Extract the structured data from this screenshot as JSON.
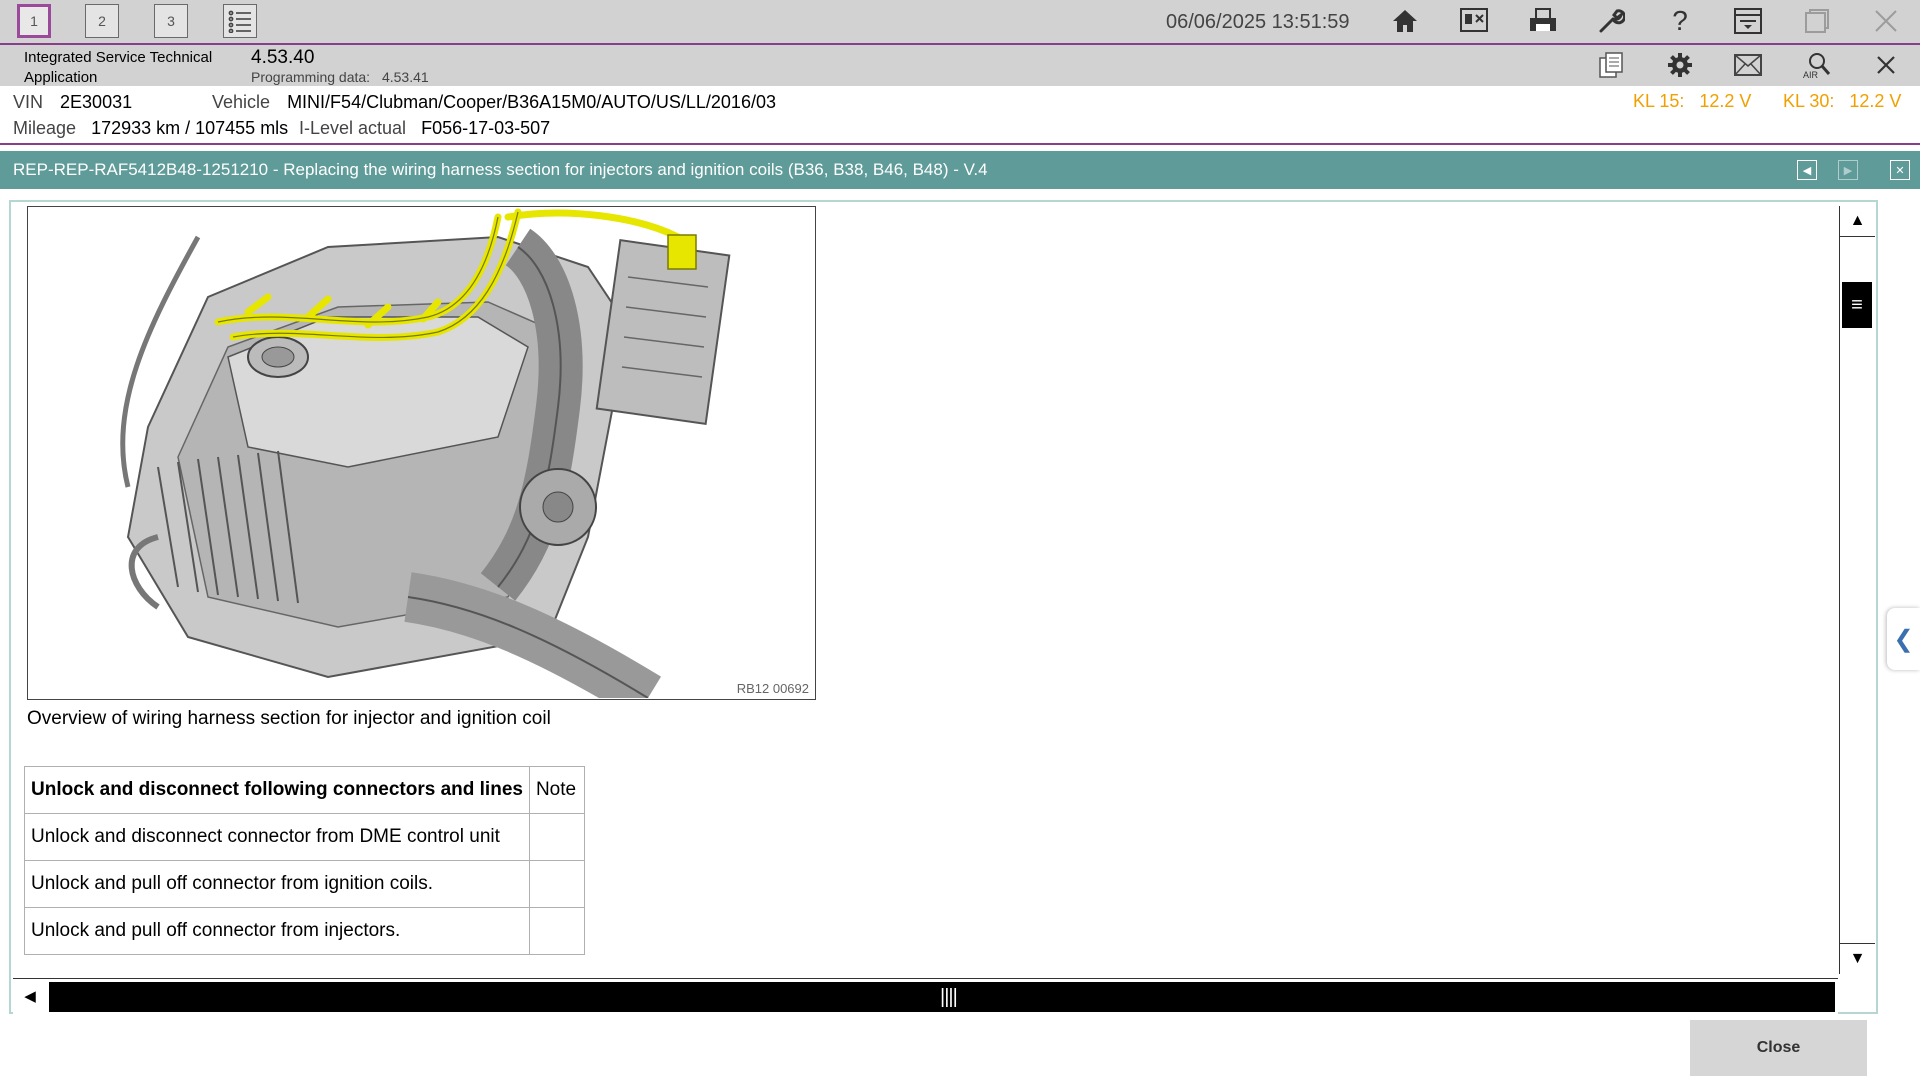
{
  "toolbar": {
    "tabs": [
      "1",
      "2",
      "3"
    ],
    "datetime": "06/06/2025 13:51:59",
    "icons": [
      "list-icon",
      "home-icon",
      "swap-icon",
      "print-icon",
      "wrench-icon",
      "help-icon",
      "download-icon",
      "window-icon",
      "close-icon"
    ]
  },
  "app": {
    "name_line1": "Integrated Service Technical",
    "name_line2": "Application",
    "version": "4.53.40",
    "programming_label": "Programming data:",
    "programming_version": "4.53.41"
  },
  "vehicle": {
    "vin_label": "VIN",
    "vin": "2E30031",
    "vehicle_label": "Vehicle",
    "vehicle": "MINI/F54/Clubman/Cooper/B36A15M0/AUTO/US/LL/2016/03",
    "mileage_label": "Mileage",
    "mileage": "172933 km / 107455 mls",
    "ilevel_label": "I-Level actual",
    "ilevel": "F056-17-03-507",
    "kl15_label": "KL 15:",
    "kl15_value": "12.2 V",
    "kl30_label": "KL 30:",
    "kl30_value": "12.2 V"
  },
  "document": {
    "title": "REP-REP-RAF5412B48-1251210 - Replacing the wiring harness section for injectors and ignition coils (B36, B38, B46, B48) - V.4",
    "figure_code": "RB12 00692",
    "caption": "Overview of wiring harness section for injector and ignition coil",
    "table": {
      "header_step": "Unlock and disconnect following connectors and lines",
      "header_note": "Note",
      "rows": [
        {
          "step": "Unlock and disconnect connector from DME control unit",
          "note": ""
        },
        {
          "step": "Unlock and pull off connector from ignition coils.",
          "note": ""
        },
        {
          "step": "Unlock and pull off connector from injectors.",
          "note": ""
        }
      ]
    }
  },
  "footer": {
    "close_label": "Close"
  },
  "colors": {
    "accent": "#8a3d8a",
    "title_bar": "#5e9b99",
    "voltage": "#f0a000",
    "harness_highlight": "#e6e600"
  }
}
